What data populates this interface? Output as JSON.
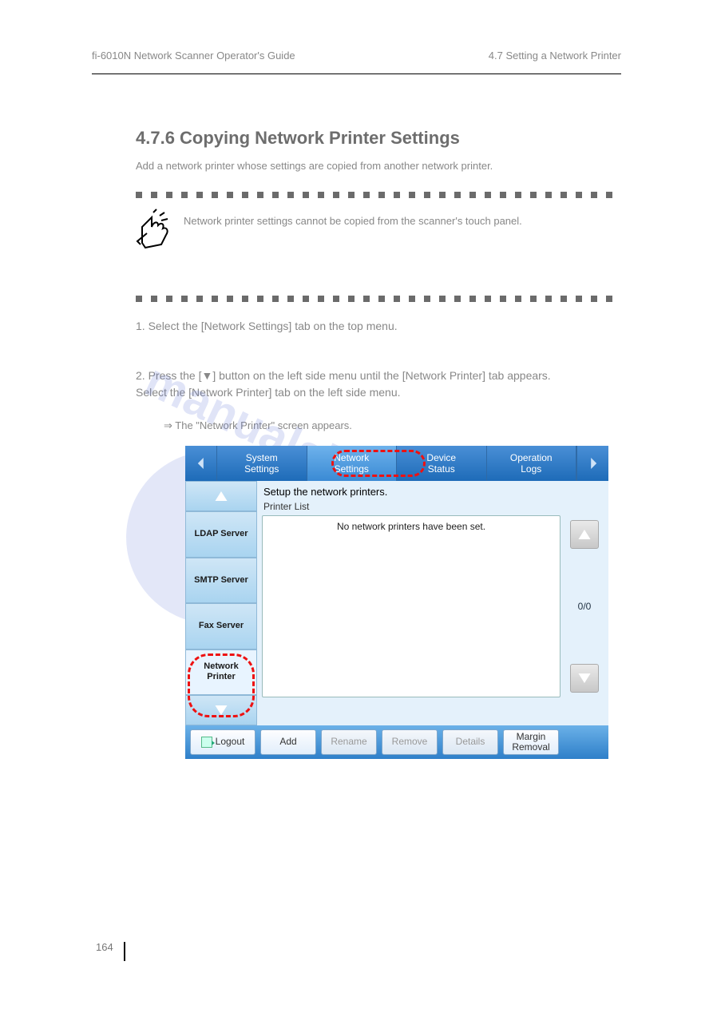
{
  "header": {
    "left": "fi-6010N Network Scanner Operator's Guide",
    "right": "4.7 Setting a Network Printer"
  },
  "section": {
    "title": "4.7.6 Copying Network Printer Settings",
    "subtitle": "Add a network printer whose settings are copied from another network printer."
  },
  "hint": "Network printer settings cannot be copied from the scanner's touch panel.",
  "steps": {
    "s1": "1. Select the [Network Settings] tab on the top menu.",
    "s2_pre": "2. Press the [",
    "s2_btn": "▼",
    "s2_mid": "] button on the left side menu until the [Network Printer] tab appears.",
    "s2b": "    Select the [Network Printer] tab on the left side menu.",
    "s2_res": "⇒ The \"Network Printer\" screen appears."
  },
  "ui": {
    "tabs": {
      "t1": "System\nSettings",
      "t2": "Network\nSettings",
      "t3": "Device\nStatus",
      "t4": "Operation\nLogs"
    },
    "sidebar": {
      "ldap": "LDAP Server",
      "smtp": "SMTP Server",
      "fax": "Fax Server",
      "np": "Network\nPrinter"
    },
    "main": {
      "title": "Setup the network printers.",
      "listLabel": "Printer List",
      "empty": "No network printers have been set.",
      "counter": "0/0"
    },
    "bottom": {
      "logout": "Logout",
      "add": "Add",
      "rename": "Rename",
      "remove": "Remove",
      "details": "Details",
      "margin": "Margin\nRemoval"
    }
  },
  "footer": {
    "page": "164"
  }
}
